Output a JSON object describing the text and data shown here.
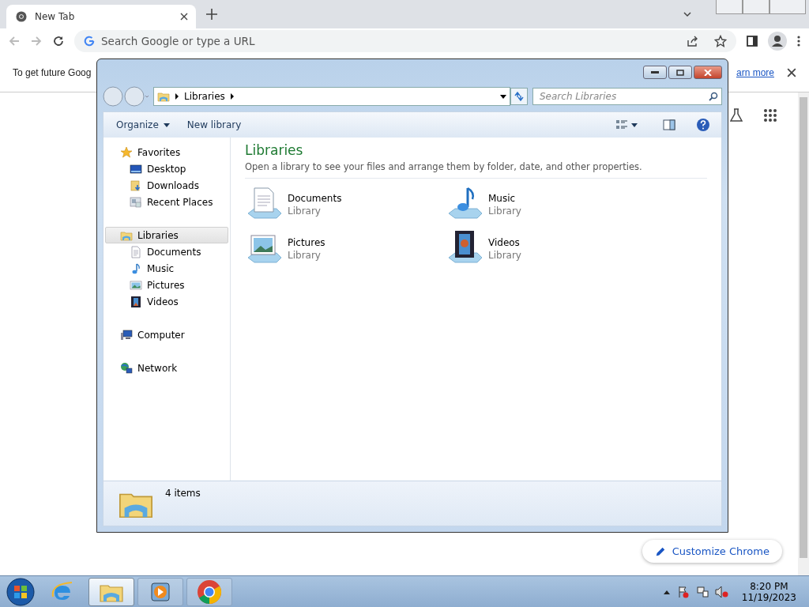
{
  "browser": {
    "tabs": [
      {
        "title": "New Tab",
        "selected": true
      }
    ],
    "omnibox": {
      "placeholder": "Search Google or type a URL"
    },
    "infobar": {
      "text": "To get future Goog",
      "link": "arn more"
    },
    "customize_button": "Customize Chrome"
  },
  "explorer": {
    "address": "Libraries",
    "search": {
      "placeholder": "Search Libraries"
    },
    "toolbar": [
      {
        "label": "Organize",
        "dropdown": true
      },
      {
        "label": "New library",
        "dropdown": false
      }
    ],
    "nav": [
      {
        "label": "Favorites",
        "kind": "star",
        "selected": false,
        "children": [
          {
            "label": "Desktop",
            "kind": "desktop",
            "selected": false
          },
          {
            "label": "Downloads",
            "kind": "download",
            "selected": false
          },
          {
            "label": "Recent Places",
            "kind": "recent",
            "selected": false
          }
        ]
      },
      {
        "label": "Libraries",
        "kind": "library",
        "selected": true,
        "children": [
          {
            "label": "Documents",
            "kind": "document",
            "selected": false
          },
          {
            "label": "Music",
            "kind": "music",
            "selected": false
          },
          {
            "label": "Pictures",
            "kind": "picture",
            "selected": false
          },
          {
            "label": "Videos",
            "kind": "video",
            "selected": false
          }
        ]
      },
      {
        "label": "Computer",
        "kind": "computer",
        "selected": false
      },
      {
        "label": "Network",
        "kind": "network",
        "selected": false
      }
    ],
    "heading": "Libraries",
    "description": "Open a library to see your files and arrange them by folder, date, and other properties.",
    "items": [
      {
        "name": "Documents",
        "type": "Library",
        "kind": "document"
      },
      {
        "name": "Music",
        "type": "Library",
        "kind": "music"
      },
      {
        "name": "Pictures",
        "type": "Library",
        "kind": "picture"
      },
      {
        "name": "Videos",
        "type": "Library",
        "kind": "video"
      }
    ],
    "status": "4 items"
  },
  "taskbar": {
    "apps": [
      {
        "kind": "ie",
        "selected": false
      },
      {
        "kind": "explorer",
        "selected": true
      },
      {
        "kind": "media",
        "selected": false
      },
      {
        "kind": "chrome",
        "selected": false
      }
    ],
    "time": "8:20 PM",
    "date": "11/19/2023"
  }
}
